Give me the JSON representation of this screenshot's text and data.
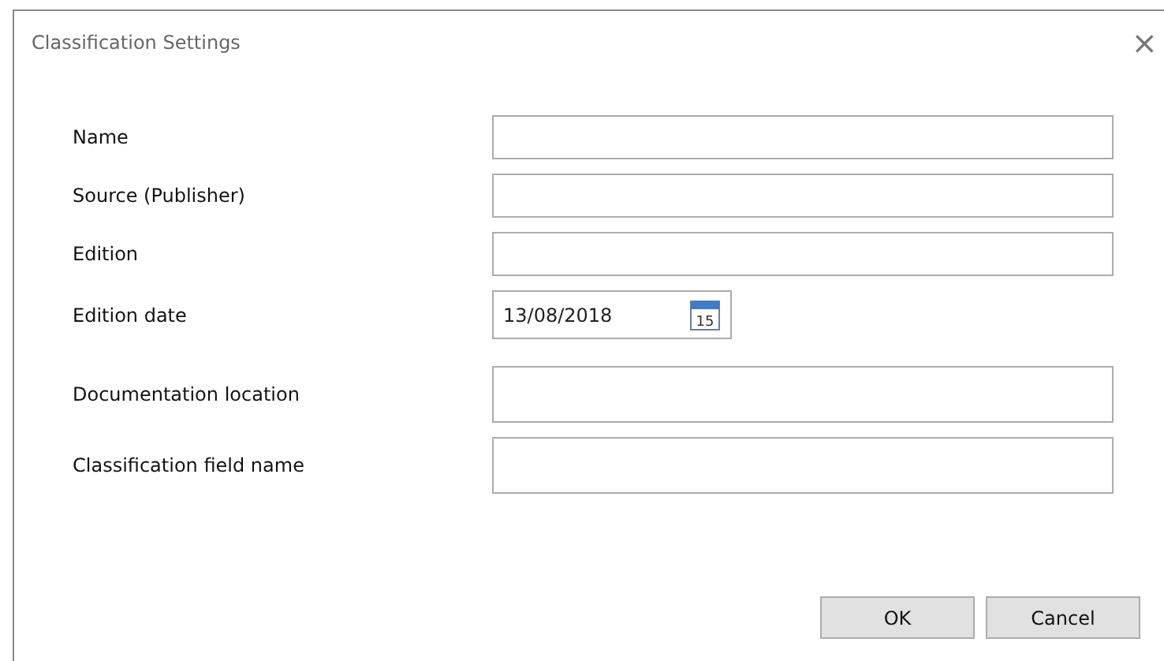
{
  "window": {
    "title": "Classification Settings",
    "close": "×"
  },
  "fields": [
    {
      "label": "Name",
      "kind": "text"
    },
    {
      "label": "Source (Publisher)",
      "kind": "text"
    },
    {
      "label": "Edition",
      "kind": "text"
    },
    {
      "label": "Edition date",
      "kind": "date",
      "value": "13/08/2018",
      "icon_text": "15"
    },
    {
      "label": "Documentation location",
      "kind": "area"
    },
    {
      "label": "Classification field name",
      "kind": "area"
    }
  ],
  "buttons": [
    "OK",
    "Cancel"
  ]
}
